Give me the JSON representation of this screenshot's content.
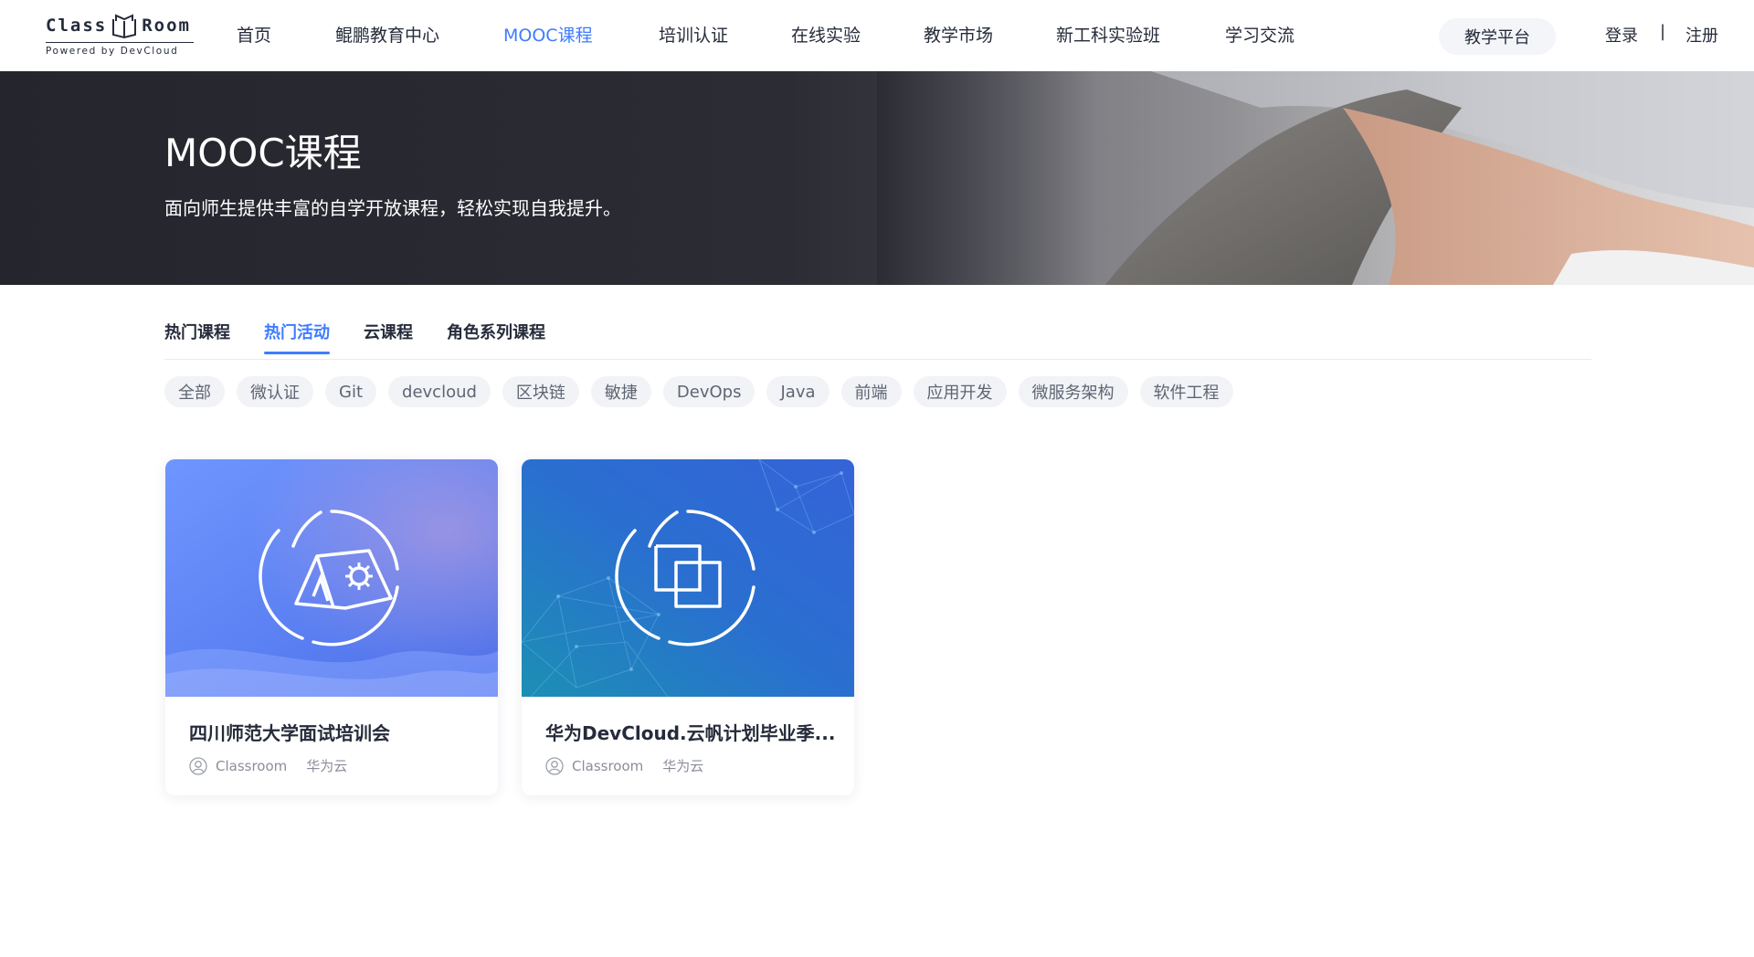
{
  "logo": {
    "word_left": "Class",
    "word_right": "Room",
    "subtitle": "Powered by DevCloud"
  },
  "nav": {
    "items": [
      {
        "label": "首页",
        "active": false
      },
      {
        "label": "鲲鹏教育中心",
        "active": false
      },
      {
        "label": "MOOC课程",
        "active": true
      },
      {
        "label": "培训认证",
        "active": false
      },
      {
        "label": "在线实验",
        "active": false
      },
      {
        "label": "教学市场",
        "active": false
      },
      {
        "label": "新工科实验班",
        "active": false
      },
      {
        "label": "学习交流",
        "active": false
      }
    ],
    "platform_button": "教学平台",
    "login": "登录",
    "separator": "|",
    "register": "注册"
  },
  "banner": {
    "title": "MOOC课程",
    "subtitle": "面向师生提供丰富的自学开放课程，轻松实现自我提升。"
  },
  "tabs": [
    {
      "label": "热门课程",
      "active": false
    },
    {
      "label": "热门活动",
      "active": true
    },
    {
      "label": "云课程",
      "active": false
    },
    {
      "label": "角色系列课程",
      "active": false
    }
  ],
  "tags": [
    "全部",
    "微认证",
    "Git",
    "devcloud",
    "区块链",
    "敏捷",
    "DevOps",
    "Java",
    "前端",
    "应用开发",
    "微服务架构",
    "软件工程"
  ],
  "cards": [
    {
      "title": "四川师范大学面试培训会",
      "author": "Classroom",
      "org": "华为云",
      "icon": "tent-gear-icon"
    },
    {
      "title": "华为DevCloud.云帆计划毕业季...",
      "author": "Classroom",
      "org": "华为云",
      "icon": "linked-squares-icon"
    }
  ],
  "colors": {
    "accent": "#3e7bff",
    "text": "#252b3a",
    "muted": "#8a8e99",
    "chip_bg": "#f2f3f6"
  }
}
